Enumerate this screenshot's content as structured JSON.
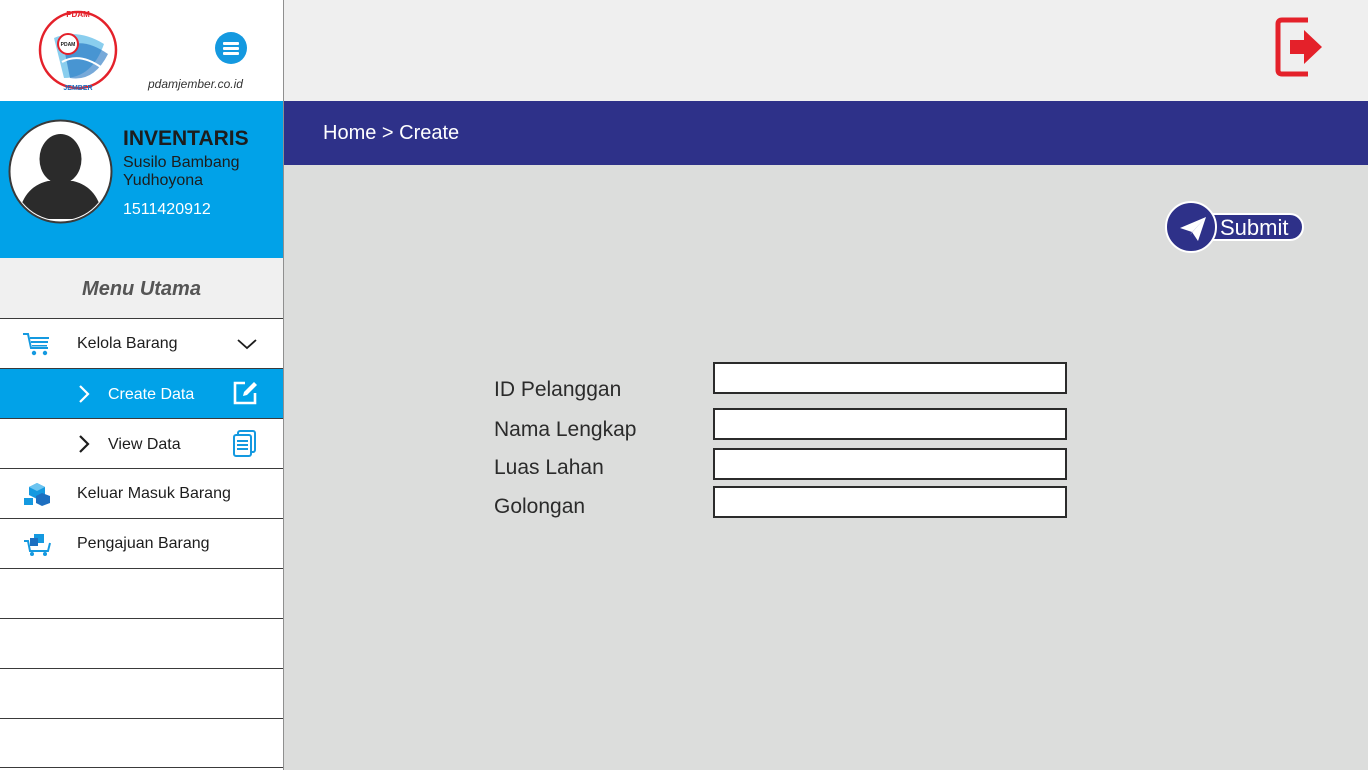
{
  "brand": {
    "site_url": "pdamjember.co.id",
    "logo_text_top": "PDAM",
    "logo_text_bottom": "JEMBER",
    "logo_text_center": "PDAM",
    "menu_icon": "hamburger-icon"
  },
  "profile": {
    "role": "INVENTARIS",
    "name": "Susilo Bambang Yudhoyona",
    "id": "1511420912",
    "avatar_icon": "user-silhouette-icon"
  },
  "menu": {
    "title": "Menu Utama",
    "items": [
      {
        "label": "Kelola Barang",
        "icon": "cart-icon",
        "expanded": true
      },
      {
        "label": "Create Data",
        "icon": "edit-icon",
        "active": true
      },
      {
        "label": "View Data",
        "icon": "document-icon"
      },
      {
        "label": "Keluar Masuk Barang",
        "icon": "boxes-icon"
      },
      {
        "label": "Pengajuan Barang",
        "icon": "cart-boxes-icon"
      }
    ]
  },
  "header": {
    "breadcrumb": "Home > Create",
    "logout_icon": "logout-icon"
  },
  "form": {
    "submit_label": "Submit",
    "submit_icon": "paper-plane-icon",
    "fields": [
      {
        "label": "ID Pelanggan",
        "value": ""
      },
      {
        "label": "Nama Lengkap",
        "value": ""
      },
      {
        "label": "Luas Lahan",
        "value": ""
      },
      {
        "label": "Golongan",
        "value": ""
      }
    ]
  },
  "colors": {
    "accent_blue": "#01a2e8",
    "navy": "#2e3189",
    "logout_red": "#e4212a",
    "content_bg": "#dcdddc",
    "topbar_bg": "#efefef"
  }
}
